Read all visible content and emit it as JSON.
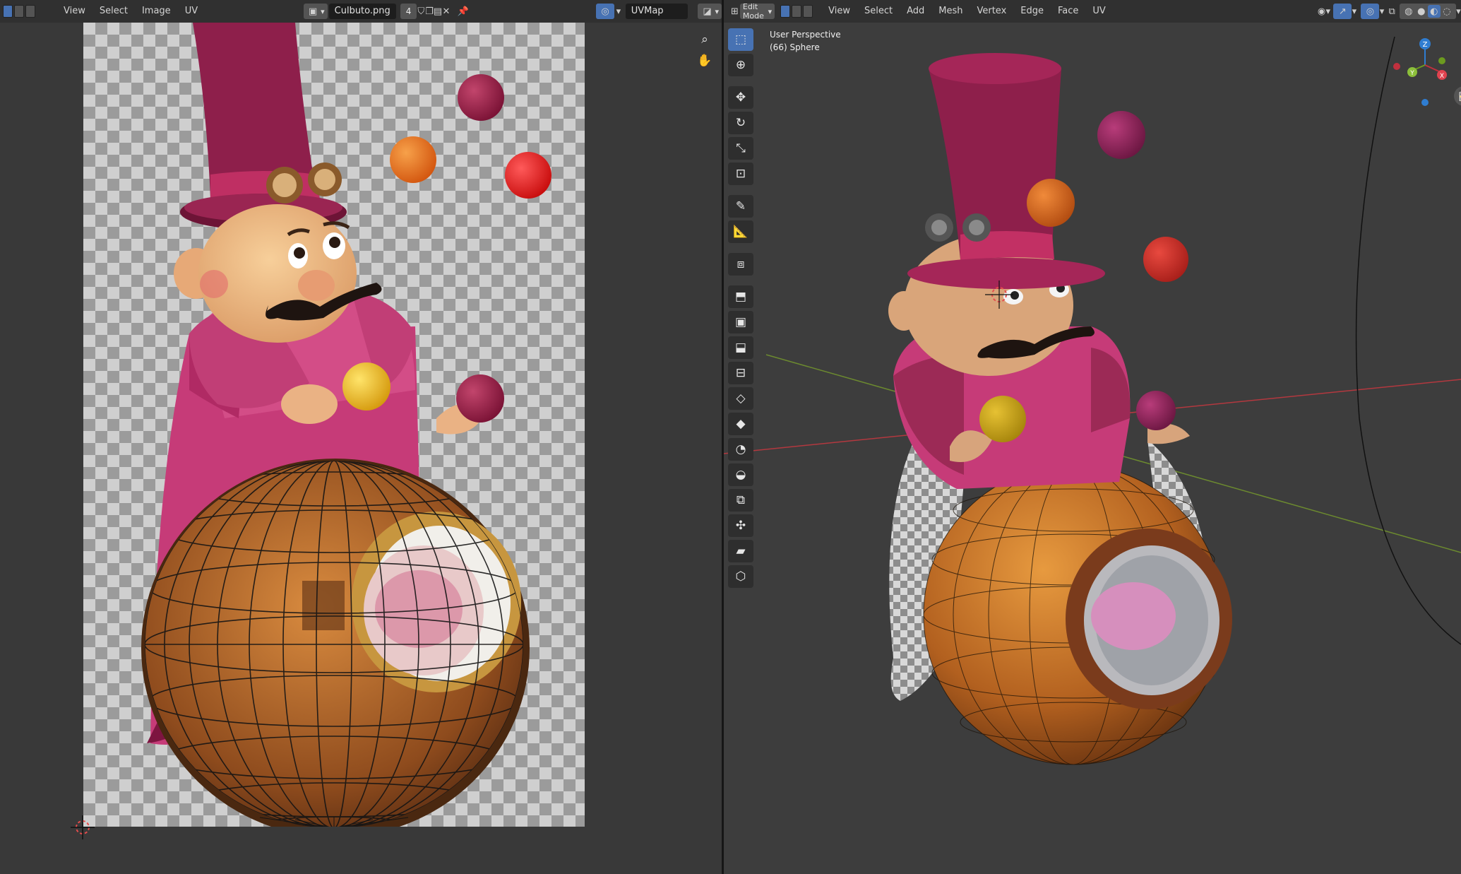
{
  "uv_editor": {
    "header": {
      "menus": [
        "View",
        "Select",
        "Image",
        "UV"
      ],
      "image_name": "Culbuto.png",
      "user_count": "4",
      "uv_map": "UVMap"
    }
  },
  "viewport": {
    "header": {
      "mode": "Edit Mode",
      "menus": [
        "View",
        "Select",
        "Add",
        "Mesh",
        "Vertex",
        "Edge",
        "Face",
        "UV"
      ]
    },
    "info": {
      "view_name": "User Perspective",
      "object_label": "(66) Sphere"
    },
    "gizmo_axes": [
      "Z",
      "Y",
      "X"
    ]
  },
  "colors": {
    "accent": "#4772b3",
    "hat": "#8e1f4b",
    "coat": "#c63b78",
    "ball_orange": "#e0701f",
    "ball_red": "#d71f1f",
    "ball_yellow": "#e3b51d",
    "sphere": "#b7662a",
    "axis_x": "#b3383f",
    "axis_y": "#6c8a2f"
  }
}
